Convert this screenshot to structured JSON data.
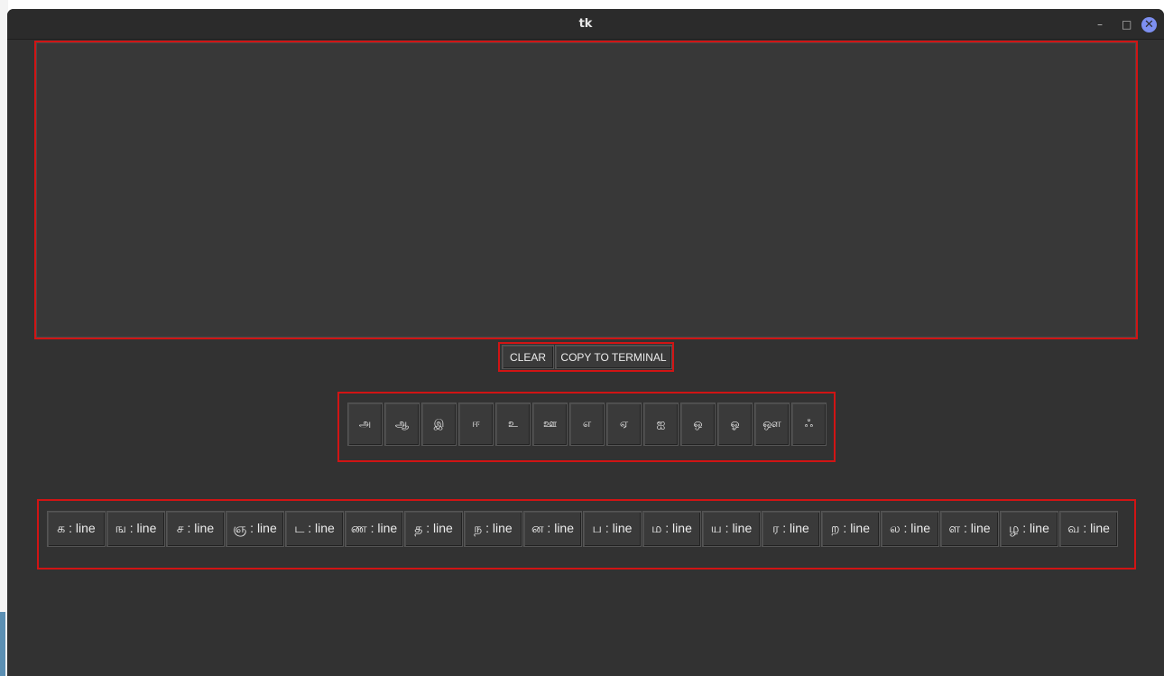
{
  "window": {
    "title": "tk",
    "minimize": "–",
    "maximize": "□",
    "close": "✕"
  },
  "text_area": {
    "value": ""
  },
  "actions": {
    "clear_label": "CLEAR",
    "copy_label": "COPY TO TERMINAL"
  },
  "vowels": [
    "அ",
    "ஆ",
    "இ",
    "ஈ",
    "உ",
    "ஊ",
    "எ",
    "ஏ",
    "ஐ",
    "ஒ",
    "ஓ",
    "ஔ",
    "ஃ"
  ],
  "consonants": [
    "க : line",
    "ங : line",
    "ச : line",
    "ஞ : line",
    "ட : line",
    "ண : line",
    "த : line",
    "ந : line",
    "ன : line",
    "ப : line",
    "ம : line",
    "ய : line",
    "ர : line",
    "ற : line",
    "ல : line",
    "ள : line",
    "ழ : line",
    "வ : line"
  ],
  "colors": {
    "highlight": "#d11414",
    "window_bg": "#323232",
    "button_bg": "#3a3a3a"
  }
}
